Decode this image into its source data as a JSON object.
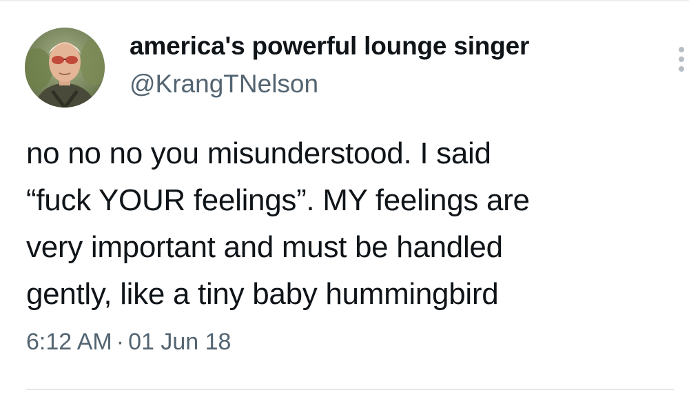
{
  "tweet": {
    "author": {
      "display_name": "america's powerful lounge singer",
      "handle": "@KrangTNelson",
      "avatar_icon": "profile-photo"
    },
    "text_lines": [
      "no no no you misunderstood. I said",
      "“fuck YOUR feelings”. MY feelings are",
      "very important and must be handled",
      "gently, like a tiny baby hummingbird"
    ],
    "time": "6:12 AM",
    "separator": "·",
    "date": "01 Jun 18",
    "more_icon": "vertical-ellipsis-icon"
  },
  "colors": {
    "text": "#0f1419",
    "secondary": "#536471",
    "icon": "#b6bec5"
  }
}
